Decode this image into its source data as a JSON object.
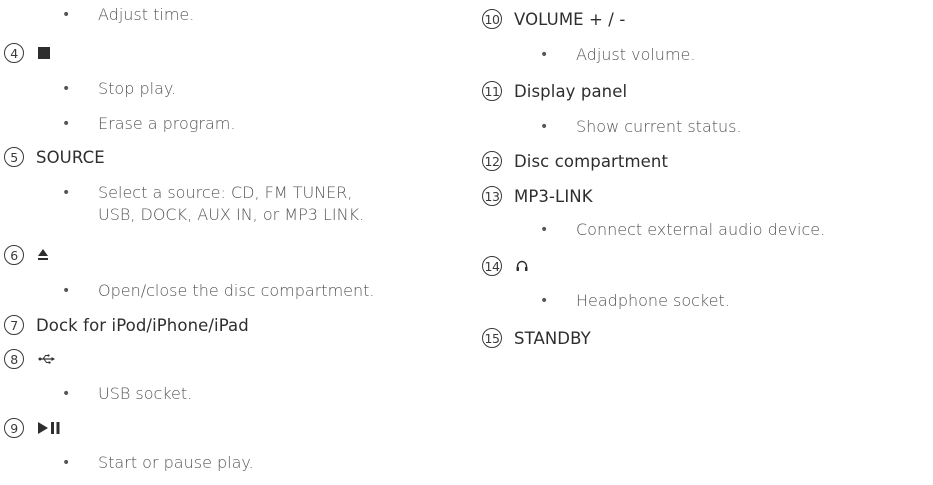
{
  "left": {
    "top_bullet": "Adjust time.",
    "item4": {
      "number": "4",
      "icon": "stop-square-icon",
      "bullets": [
        "Stop play.",
        "Erase a program."
      ]
    },
    "item5": {
      "number": "5",
      "title": "SOURCE",
      "bullet_line1": "Select a source: CD, FM TUNER,",
      "bullet_line2": "USB, DOCK, AUX IN, or MP3 LINK."
    },
    "item6": {
      "number": "6",
      "icon": "eject-icon",
      "bullet": "Open/close the disc compartment."
    },
    "item7": {
      "number": "7",
      "title": "Dock for iPod/iPhone/iPad"
    },
    "item8": {
      "number": "8",
      "icon": "usb-icon",
      "bullet": "USB socket."
    },
    "item9": {
      "number": "9",
      "icon": "play-pause-icon",
      "bullet": "Start or pause play."
    }
  },
  "right": {
    "item10": {
      "number": "10",
      "title": "VOLUME + / -",
      "bullet": "Adjust volume."
    },
    "item11": {
      "number": "11",
      "title": "Display panel",
      "bullet": "Show current status."
    },
    "item12": {
      "number": "12",
      "title": "Disc compartment"
    },
    "item13": {
      "number": "13",
      "title": "MP3-LINK",
      "bullet": "Connect external audio device."
    },
    "item14": {
      "number": "14",
      "icon": "headphone-icon",
      "bullet": "Headphone socket."
    },
    "item15": {
      "number": "15",
      "title": "STANDBY"
    }
  },
  "bullet_char": "•"
}
